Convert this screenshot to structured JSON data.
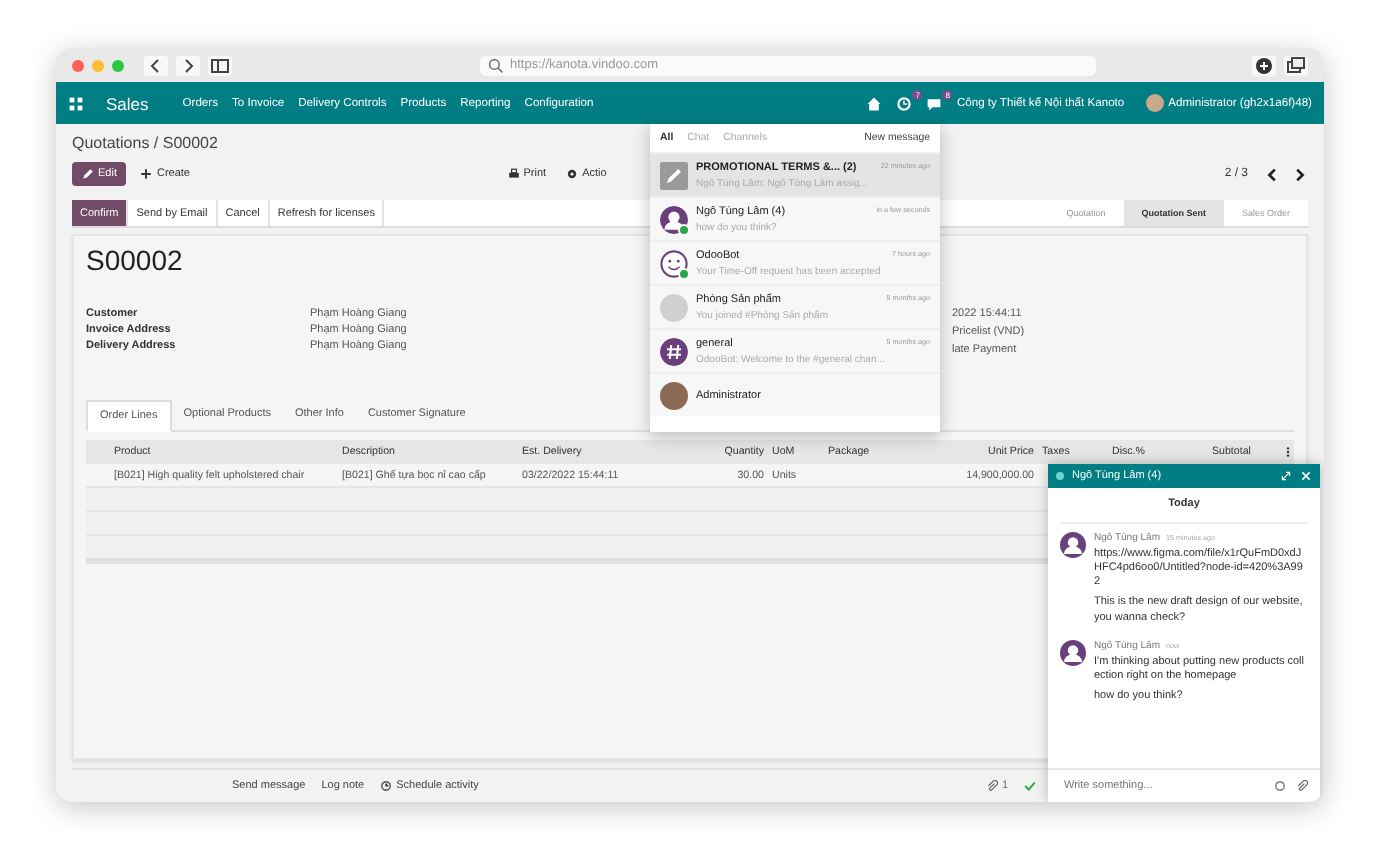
{
  "browser": {
    "url": "https://kanota.vindoo.com"
  },
  "navbar": {
    "app": "Sales",
    "menu": [
      "Orders",
      "To Invoice",
      "Delivery Controls",
      "Products",
      "Reporting",
      "Configuration"
    ],
    "activity_badge": "7",
    "message_badge": "8",
    "company": "Công ty Thiết kế Nội thất Kanoto",
    "user": "Administrator (gh2x1a6f)48)"
  },
  "breadcrumb": "Quotations / S00002",
  "control_panel": {
    "edit": "Edit",
    "create": "Create",
    "print": "Print",
    "action": "Actio",
    "pager": "2 / 3"
  },
  "status_buttons": [
    "Confirm",
    "Send by Email",
    "Cancel",
    "Refresh for licenses"
  ],
  "stages": [
    {
      "label": "Quotation",
      "selected": false
    },
    {
      "label": "Quotation Sent",
      "selected": true
    },
    {
      "label": "Sales Order",
      "selected": false
    }
  ],
  "form": {
    "name": "S00002",
    "fields": [
      {
        "label": "Customer",
        "value": "Phạm Hoàng Giang"
      },
      {
        "label": "Invoice Address",
        "value": "Phạm Hoàng Giang"
      },
      {
        "label": "Delivery Address",
        "value": "Phạm Hoàng Giang"
      }
    ],
    "right_values": [
      "2022 15:44:11",
      "Pricelist (VND)",
      "late Payment"
    ]
  },
  "notebook": [
    {
      "label": "Order Lines",
      "selected": true
    },
    {
      "label": "Optional Products",
      "selected": false
    },
    {
      "label": "Other Info",
      "selected": false
    },
    {
      "label": "Customer Signature",
      "selected": false
    }
  ],
  "table": {
    "columns": [
      "Product",
      "Description",
      "Est. Delivery",
      "Quantity",
      "UoM",
      "Package",
      "Unit Price",
      "Taxes",
      "Disc.%",
      "Subtotal"
    ],
    "rows": [
      [
        "[B021] High quality felt upholstered chair",
        "[B021] Ghế tựa bọc nỉ cao cấp",
        "03/22/2022 15:44:11",
        "30.00",
        "Units",
        "",
        "14,900,000.00"
      ]
    ]
  },
  "chatter": {
    "send": "Send message",
    "log": "Log note",
    "schedule": "Schedule activity",
    "attachments": "1"
  },
  "messaging_menu": {
    "tabs": [
      {
        "label": "All",
        "selected": true
      },
      {
        "label": "Chat",
        "selected": false
      },
      {
        "label": "Channels",
        "selected": false
      }
    ],
    "new_message": "New message",
    "items": [
      {
        "kind": "pencil",
        "title": "PROMOTIONAL TERMS &... (2)",
        "time": "22 minutes ago",
        "preview": "Ngô Tùng Lâm: Ngô Tùng Lâm assig...",
        "selected": true,
        "online": false
      },
      {
        "kind": "person",
        "title": "Ngô Tùng Lâm (4)",
        "time": "in a few seconds",
        "preview": "how do you think?",
        "selected": false,
        "online": true
      },
      {
        "kind": "bot",
        "title": "OdooBot",
        "time": "7 hours ago",
        "preview": "Your Time-Off request has been accepted",
        "selected": false,
        "online": true
      },
      {
        "kind": "group",
        "title": "Phòng Sản phẩm",
        "time": "5 months ago",
        "preview": "You joined #Phòng Sản phẩm",
        "selected": false,
        "online": false
      },
      {
        "kind": "channel",
        "title": "general",
        "time": "5 months ago",
        "preview": "OdooBot: Welcome to the #general chan...",
        "selected": false,
        "online": false
      },
      {
        "kind": "photo",
        "title": "Administrator",
        "selected": false,
        "online": false
      }
    ]
  },
  "chat_window": {
    "title": "Ngô Tùng Lâm (4)",
    "day": "Today",
    "messages": [
      {
        "author": "Ngô Tùng Lâm",
        "time": "15 minutes ago",
        "paragraphs": [
          "https://www.figma.com/file/x1rQuFmD0xdJHFC4pd6oo0/Untitled?node-id=420%3A992",
          "This is the new draft design of our website, you wanna check?"
        ]
      },
      {
        "author": "Ngô Tùng Lâm",
        "time": "now",
        "paragraphs": [
          "I'm thinking about putting new products collection right on the homepage",
          "how do you think?"
        ]
      }
    ],
    "composer": {
      "placeholder": "Write something..."
    }
  }
}
